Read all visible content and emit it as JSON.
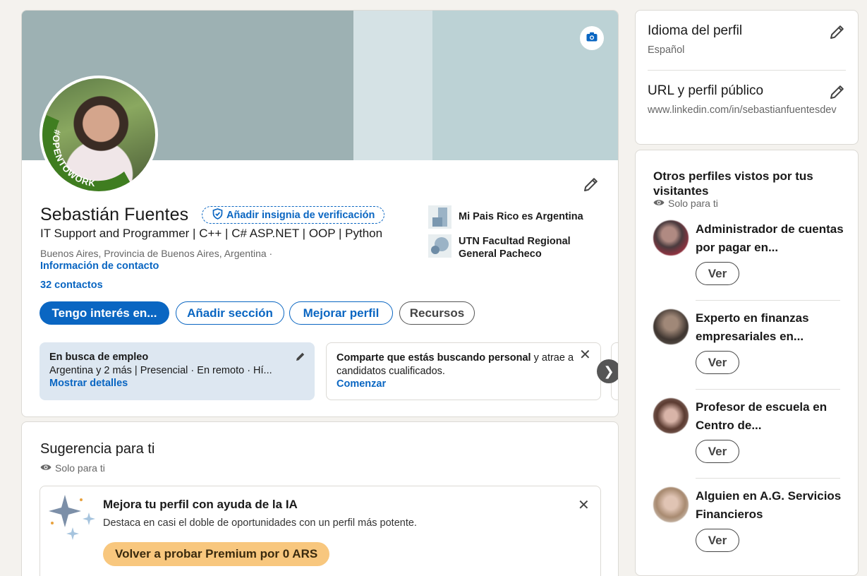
{
  "profile": {
    "name": "Sebastián Fuentes",
    "verify_badge": "Añadir insignia de verificación",
    "headline": "IT Support and Programmer | C++ | C# ASP.NET | OOP | Python",
    "location": "Buenos Aires, Provincia de Buenos Aires, Argentina ·",
    "contact_info": "Información de contacto",
    "connections": "32 contactos",
    "open_to_work_frame": "#OPENTOWORK",
    "orgs": [
      {
        "name": "Mi Pais Rico es Argentina"
      },
      {
        "name": "UTN Facultad Regional General Pacheco"
      }
    ],
    "buttons": {
      "interested": "Tengo interés en...",
      "add_section": "Añadir sección",
      "improve": "Mejorar perfil",
      "resources": "Recursos"
    },
    "open_card": {
      "title": "En busca de empleo",
      "details": "Argentina y 2 más | Presencial · En remoto · Hí...",
      "link": "Mostrar detalles"
    },
    "share_card": {
      "bold": "Comparte que estás buscando personal",
      "rest": " y atrae a candidatos cualificados.",
      "link": "Comenzar"
    }
  },
  "suggest": {
    "title": "Sugerencia para ti",
    "private": "Solo para ti",
    "ai_title": "Mejora tu perfil con ayuda de la IA",
    "ai_desc": "Destaca en casi el doble de oportunidades con un perfil más potente.",
    "premium_btn": "Volver a probar Premium por 0 ARS"
  },
  "sidebar": {
    "lang_title": "Idioma del perfil",
    "lang_value": "Español",
    "url_title": "URL y perfil público",
    "url_value": "www.linkedin.com/in/sebastianfuentesdev",
    "others_title": "Otros perfiles vistos por tus visitantes",
    "others_private": "Solo para ti",
    "people": [
      {
        "title": "Administrador de cuentas por pagar en...",
        "button": "Ver"
      },
      {
        "title": "Experto en finanzas empresariales en...",
        "button": "Ver"
      },
      {
        "title": "Profesor de escuela en Centro de...",
        "button": "Ver"
      },
      {
        "title": "Alguien en A.G. Servicios Financieros",
        "button": "Ver"
      }
    ]
  },
  "colors": {
    "accent": "#0a66c2",
    "open_to_work_green": "#3f7d20",
    "premium": "#f8c77e"
  }
}
